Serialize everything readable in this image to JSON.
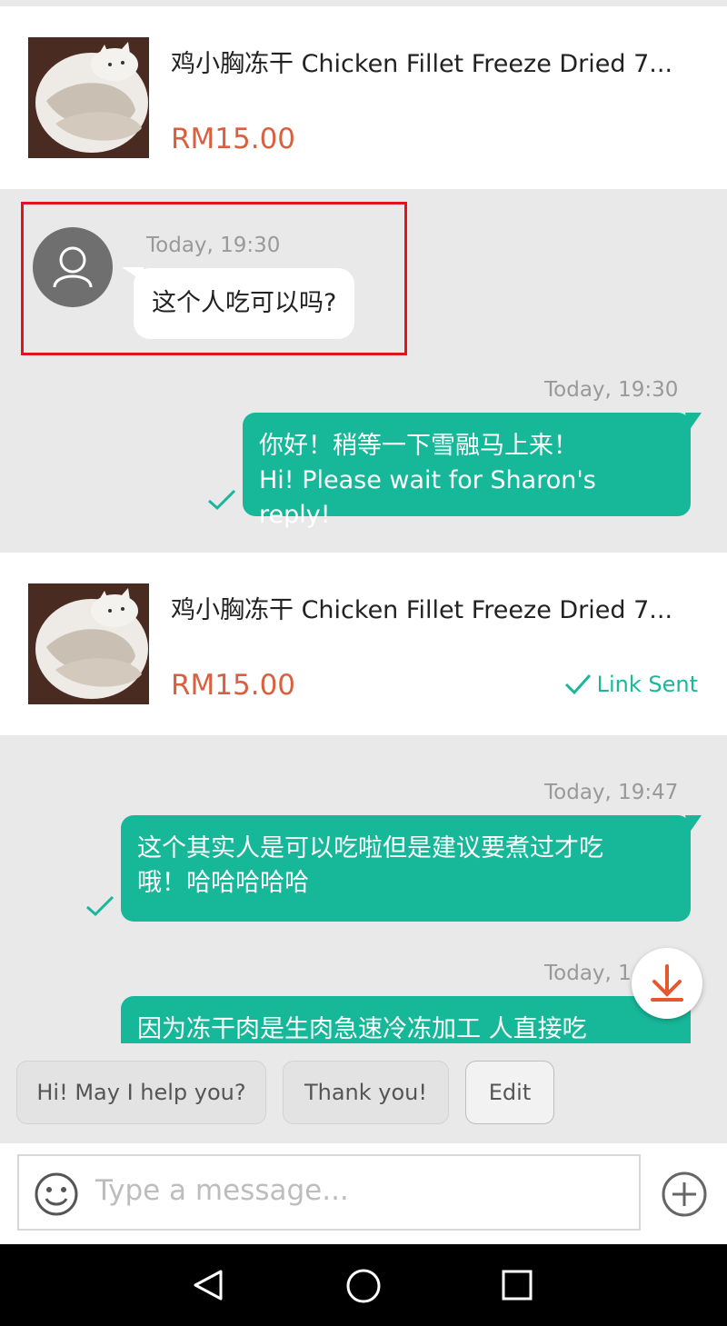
{
  "products": [
    {
      "title": "鸡小胸冻干 Chicken Fillet Freeze Dried 7...",
      "price": "RM15.00",
      "status": ""
    },
    {
      "title": "鸡小胸冻干 Chicken Fillet Freeze Dried 7...",
      "price": "RM15.00",
      "status": "Link Sent"
    }
  ],
  "messages": [
    {
      "direction": "incoming",
      "time": "Today, 19:30",
      "lines": [
        "这个人吃可以吗?"
      ]
    },
    {
      "direction": "outgoing",
      "time": "Today, 19:30",
      "lines": [
        "你好！稍等一下雪融马上来！",
        "Hi! Please wait for Sharon's reply!"
      ]
    },
    {
      "direction": "outgoing",
      "time": "Today, 19:47",
      "lines": [
        "这个其实人是可以吃啦但是建议要煮过才吃",
        "哦！哈哈哈哈哈"
      ]
    },
    {
      "direction": "outgoing",
      "time": "Today, 1",
      "lines": [
        "因为冻干肉是生肉急速冷冻加工 人直接吃"
      ]
    }
  ],
  "quick_replies": [
    "Hi! May I help you?",
    "Thank you!",
    "Edit"
  ],
  "input": {
    "placeholder": "Type a message..."
  },
  "icons": {
    "avatar": "user-avatar-icon",
    "emoji": "emoji-icon",
    "add": "plus-circle-icon",
    "download": "download-icon",
    "nav_back": "triangle-back-icon",
    "nav_home": "circle-home-icon",
    "nav_recents": "square-recents-icon",
    "read_tick": "checkmark-icon"
  },
  "colors": {
    "accent": "#17b79a",
    "price": "#d9603f",
    "highlight": "#e0141e",
    "download": "#e5572f"
  }
}
